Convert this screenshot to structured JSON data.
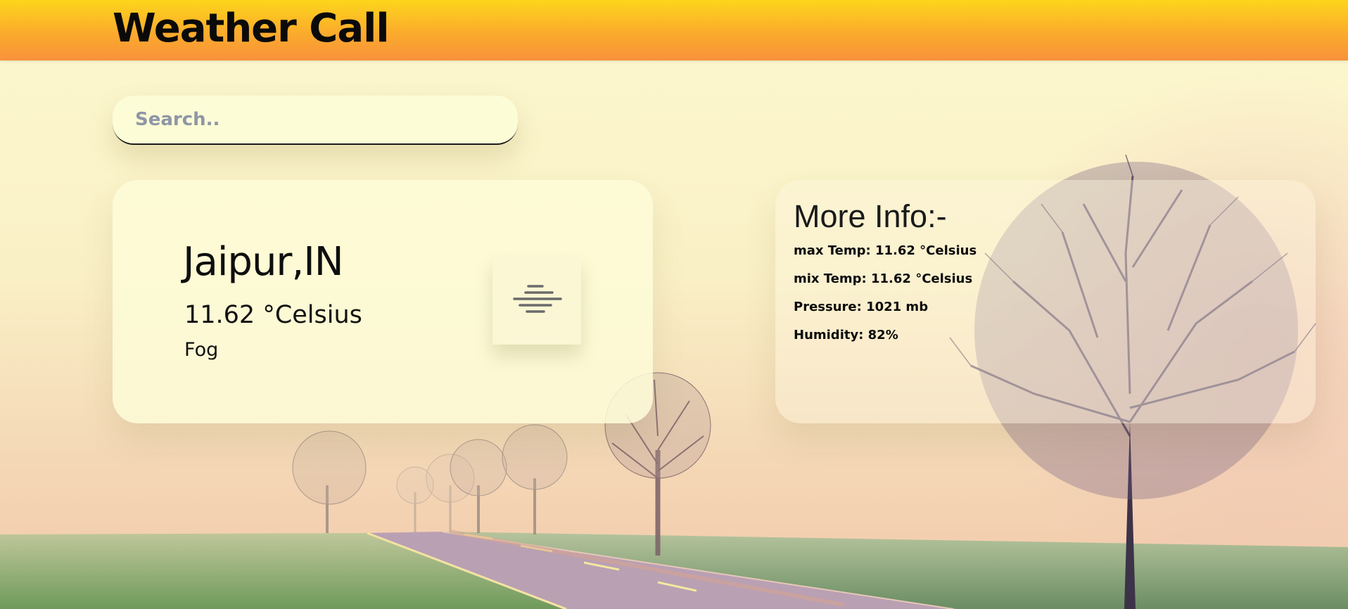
{
  "header": {
    "title": "Weather Call"
  },
  "search": {
    "placeholder": "Search..",
    "value": ""
  },
  "current": {
    "city": "Jaipur,IN",
    "temperature": "11.62 °Celsius",
    "condition": "Fog",
    "icon": "fog-icon"
  },
  "more_info": {
    "title": "More Info:-",
    "rows": [
      {
        "text": "max Temp: 11.62 °Celsius"
      },
      {
        "text": "mix Temp: 11.62 °Celsius"
      },
      {
        "text": "Pressure: 1021 mb"
      },
      {
        "text": "Humidity: 82%"
      }
    ]
  },
  "colors": {
    "header_top": "#fdd51b",
    "header_bottom": "#f8923b",
    "card_bg": "#fdfbd7",
    "text": "#0e0e0e"
  }
}
